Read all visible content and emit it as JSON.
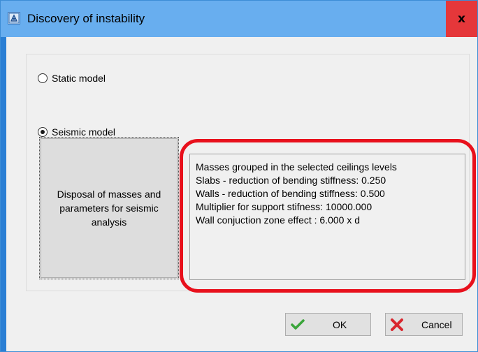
{
  "window": {
    "title": "Discovery of instability",
    "close_label": "x",
    "icon": "app-icon"
  },
  "options": {
    "static_model_label": "Static model",
    "seismic_model_label": "Seismic model",
    "selected": "seismic"
  },
  "seismic_button": {
    "line1": "Disposal of masses and",
    "line2": "parameters for seismic",
    "line3": "analysis"
  },
  "info": {
    "lines": [
      "Masses grouped in the selected ceilings levels",
      "Slabs - reduction of bending stiffness: 0.250",
      "Walls - reduction of bending stiffness: 0.500",
      "Multiplier for support stifness: 10000.000",
      "Wall conjuction zone effect : 6.000 x d"
    ]
  },
  "buttons": {
    "ok_label": "OK",
    "ok_icon": "check-icon",
    "cancel_label": "Cancel",
    "cancel_icon": "x-icon"
  },
  "colors": {
    "titlebar": "#68aeef",
    "close_hover": "#e5373a",
    "highlight": "#e8101c",
    "ok_check": "#3aa53a",
    "cancel_x": "#d9262e"
  }
}
